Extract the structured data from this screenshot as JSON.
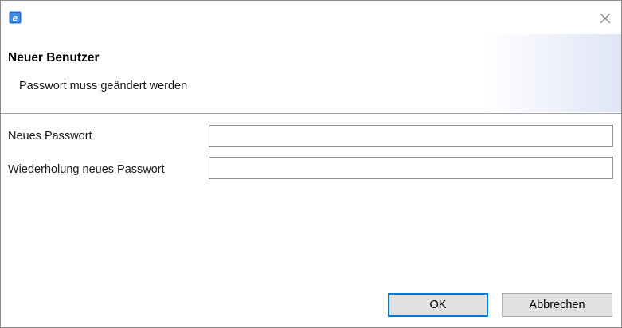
{
  "window": {
    "app_icon_letter": "e"
  },
  "header": {
    "title": "Neuer Benutzer",
    "message": "Passwort muss geändert werden"
  },
  "form": {
    "new_password_label": "Neues Passwort",
    "new_password_value": "",
    "repeat_password_label": "Wiederholung neues Passwort",
    "repeat_password_value": ""
  },
  "buttons": {
    "ok_label": "OK",
    "cancel_label": "Abbrechen"
  },
  "colors": {
    "accent": "#0078d7",
    "app_icon": "#1e6fd0"
  },
  "icons": {
    "app": "app-logo-icon",
    "close": "close-icon"
  }
}
